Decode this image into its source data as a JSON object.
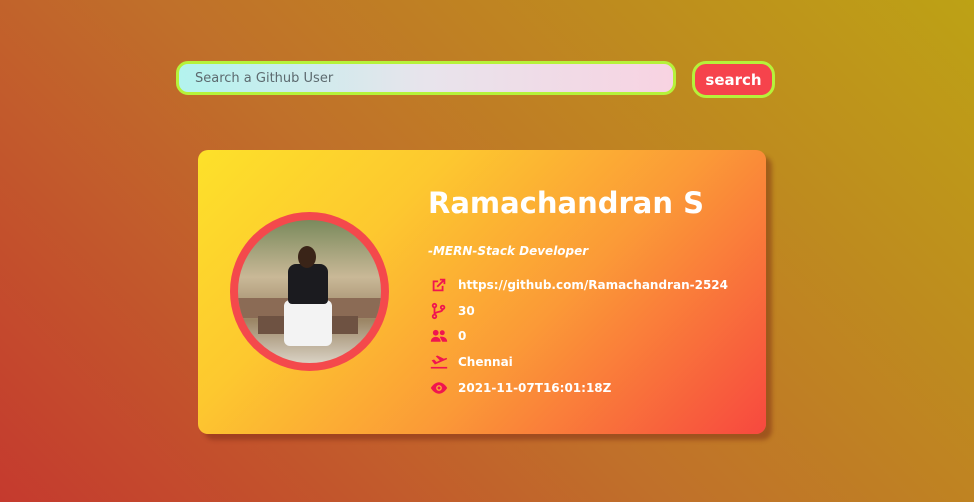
{
  "search": {
    "placeholder": "Search a Github User",
    "button_label": "search"
  },
  "profile": {
    "name": "Ramachandran S",
    "bio": "-MERN-Stack Developer",
    "url": "https://github.com/Ramachandran-2524",
    "repos": "30",
    "followers": "0",
    "location": "Chennai",
    "created_at": "2021-11-07T16:01:18Z"
  },
  "icons": {
    "link": "external-link-icon",
    "repos": "code-branch-icon",
    "followers": "users-icon",
    "location": "plane-departure-icon",
    "created": "eye-icon"
  },
  "colors": {
    "accent": "#f6434c",
    "border": "#b6f23a",
    "icon": "#f0154f"
  }
}
